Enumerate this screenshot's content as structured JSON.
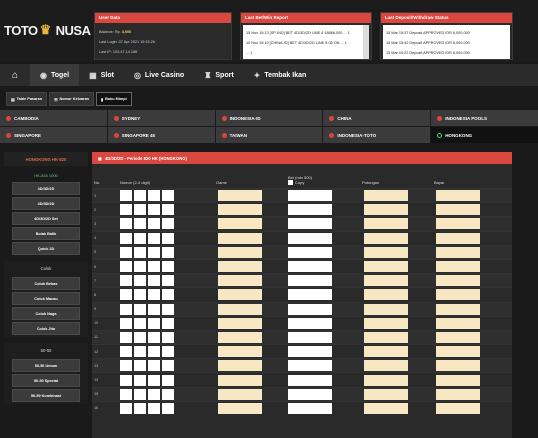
{
  "brand": {
    "left": "TOTO",
    "right": "NUSA"
  },
  "panels": {
    "user": {
      "title": "User Data",
      "lines": [
        "Balance: Rp. 3,000",
        "Last Login: 07 Apr 2021 15:15:26",
        "Last IP: 103.47.14.186"
      ],
      "amount": "3,000"
    },
    "bets": {
      "title": "Last Bet/Win Report",
      "lines": [
        "15 Nov 15:13 [SP-IND] BET 4D/3D/2D LINE 8 18866,000 ... 1",
        "15 Nov 15:19 [CHINA-ID] BET 4D/3D/2D LINE 8 05 ON ... 1",
        "... 1"
      ]
    },
    "deposit": {
      "title": "Last Deposit/Withdraw Status",
      "lines": [
        "15 Mar 15:37 Deposit APPROVED IDR 6,000,000",
        "15 Mar 15:42 Deposit APPROVED IDR 6,000,000",
        "15 Mar 15:22 Deposit APPROVED IDR 6,000,000"
      ]
    }
  },
  "nav": {
    "items": [
      {
        "label": "Togel",
        "icon": "ball-icon",
        "active": true
      },
      {
        "label": "Slot",
        "icon": "slot-icon",
        "active": false
      },
      {
        "label": "Live Casino",
        "icon": "casino-icon",
        "active": false
      },
      {
        "label": "Sport",
        "icon": "trophy-icon",
        "active": false
      },
      {
        "label": "Tembak Ikan",
        "icon": "fish-icon",
        "active": false
      }
    ]
  },
  "subtabs": [
    {
      "label": "Table Pasaran",
      "active": false
    },
    {
      "label": "Nomor Keluaran",
      "active": false
    },
    {
      "label": "Buku Mimpi",
      "active": true
    }
  ],
  "markets": [
    {
      "label": "CAMBODIA",
      "active": false
    },
    {
      "label": "SYDNEY",
      "active": false
    },
    {
      "label": "INDONESIA-ID",
      "active": false
    },
    {
      "label": "CHINA",
      "active": false
    },
    {
      "label": "INDONESIA POOLS",
      "active": false
    },
    {
      "label": "SINGAPORE",
      "active": false
    },
    {
      "label": "SINGAPORE 45",
      "active": false
    },
    {
      "label": "TAIWAN",
      "active": false
    },
    {
      "label": "INDONESIA-TOTO",
      "active": false
    },
    {
      "label": "HONGKONG",
      "active": true
    }
  ],
  "sidebar": {
    "title": "HONGKONG HK-820",
    "status": "HK-818 1000",
    "group1": [
      "4D/3D/2D",
      "4D/3D/2D",
      "4D/3D/2D Set",
      "Bolak Balik",
      "Quick 2D"
    ],
    "group2_head": "Colok",
    "group2": [
      "Colok Bebas",
      "Colok Macau",
      "Colok Naga",
      "Colok Jitu"
    ],
    "group3_head": "50-50",
    "group3": [
      "50-50 Umum",
      "50-50 Special",
      "50-50 Kombinasi"
    ]
  },
  "table": {
    "title": "4D/3D/2D - Periode 820 HK (HONGKONG)",
    "headers": {
      "no": "No.",
      "nomor": "Nomor (2-4 digit)",
      "game": "Game",
      "bet": "Bet (min 500)",
      "copy": "Copy",
      "potongan": "Potongan",
      "bayar": "Bayar"
    },
    "rows": [
      "1",
      "2",
      "3",
      "4",
      "5",
      "6",
      "7",
      "8",
      "9",
      "10",
      "11",
      "12",
      "13",
      "14",
      "15",
      "16"
    ]
  }
}
